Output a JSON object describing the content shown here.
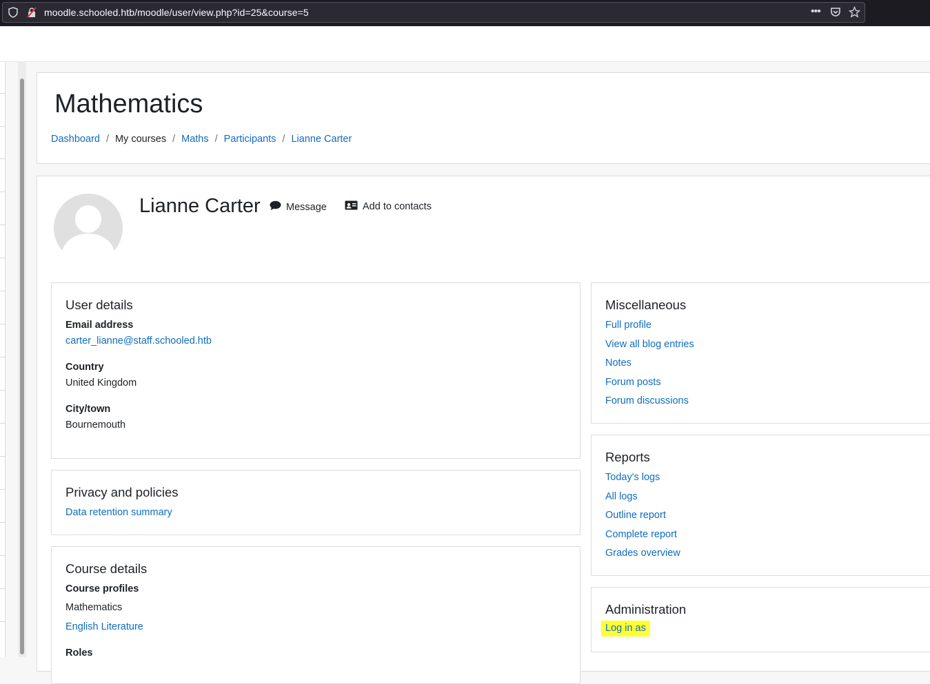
{
  "browser": {
    "url": "moodle.schooled.htb/moodle/user/view.php?id=25&course=5",
    "icons": [
      "shield-icon",
      "insecure-lock-icon",
      "more-icon",
      "pocket-icon",
      "star-icon"
    ]
  },
  "header": {
    "course_title": "Mathematics",
    "breadcrumb": [
      "Dashboard",
      "My courses",
      "Maths",
      "Participants",
      "Lianne Carter"
    ]
  },
  "profile": {
    "name": "Lianne Carter",
    "message_label": "Message",
    "add_contact_label": "Add to contacts"
  },
  "user_details": {
    "title": "User details",
    "email_label": "Email address",
    "email_value": "carter_lianne@staff.schooled.htb",
    "country_label": "Country",
    "country_value": "United Kingdom",
    "city_label": "City/town",
    "city_value": "Bournemouth"
  },
  "privacy": {
    "title": "Privacy and policies",
    "link": "Data retention summary"
  },
  "course_details": {
    "title": "Course details",
    "profiles_label": "Course profiles",
    "profiles": [
      "Mathematics",
      "English Literature"
    ],
    "roles_label": "Roles"
  },
  "misc": {
    "title": "Miscellaneous",
    "links": [
      "Full profile",
      "View all blog entries",
      "Notes",
      "Forum posts",
      "Forum discussions"
    ]
  },
  "reports": {
    "title": "Reports",
    "links": [
      "Today's logs",
      "All logs",
      "Outline report",
      "Complete report",
      "Grades overview"
    ]
  },
  "administration": {
    "title": "Administration",
    "link": "Log in as",
    "highlight_color": "#ffff33"
  },
  "colors": {
    "link": "#0f6cbf",
    "text": "#1d2125"
  }
}
